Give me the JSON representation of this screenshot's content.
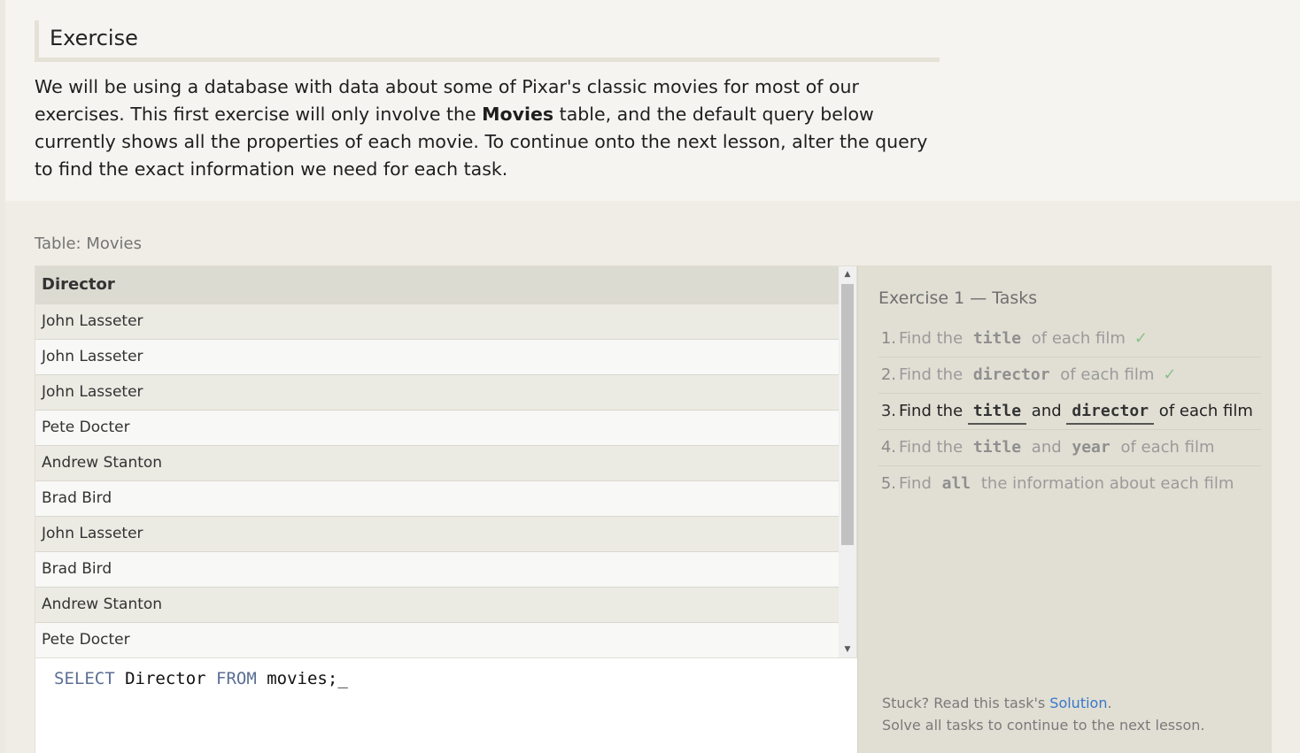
{
  "exercise_section": {
    "heading": "Exercise",
    "intro_part1": "We will be using a database with data about some of Pixar's classic movies for most of our exercises. This first exercise will only involve the ",
    "intro_bold": "Movies",
    "intro_part2": " table, and the default query below currently shows all the properties of each movie. To continue onto the next lesson, alter the query to find the exact information we need for each task."
  },
  "table": {
    "caption": "Table: Movies",
    "column_header": "Director",
    "rows": [
      "John Lasseter",
      "John Lasseter",
      "John Lasseter",
      "Pete Docter",
      "Andrew Stanton",
      "Brad Bird",
      "John Lasseter",
      "Brad Bird",
      "Andrew Stanton",
      "Pete Docter"
    ]
  },
  "editor": {
    "kw_select": "SELECT",
    "column": " Director ",
    "kw_from": "FROM",
    "rest": " movies;",
    "cursor": "_"
  },
  "tasks": {
    "title": "Exercise 1 — Tasks",
    "items": [
      {
        "num": "1.",
        "p1": "Find the ",
        "c1": "title",
        "p2": " of each film",
        "c2": "",
        "p3": "",
        "check": "✓"
      },
      {
        "num": "2.",
        "p1": "Find the ",
        "c1": "director",
        "p2": " of each film",
        "c2": "",
        "p3": "",
        "check": "✓"
      },
      {
        "num": "3.",
        "p1": "Find the ",
        "c1": "title",
        "p2": " and ",
        "c2": "director",
        "p3": " of each film",
        "check": ""
      },
      {
        "num": "4.",
        "p1": "Find the ",
        "c1": "title",
        "p2": " and ",
        "c2": "year",
        "p3": " of each film",
        "check": ""
      },
      {
        "num": "5.",
        "p1": "Find ",
        "c1": "all",
        "p2": " the information about each film",
        "c2": "",
        "p3": "",
        "check": ""
      }
    ],
    "stuck_prefix": "Stuck? Read this task's ",
    "solution_link": "Solution",
    "stuck_suffix": ".",
    "solve_all": "Solve all tasks to continue to the next lesson."
  },
  "colors": {
    "keyword": "#5b6f94",
    "link": "#3a78c9",
    "check": "#8bc08b"
  }
}
